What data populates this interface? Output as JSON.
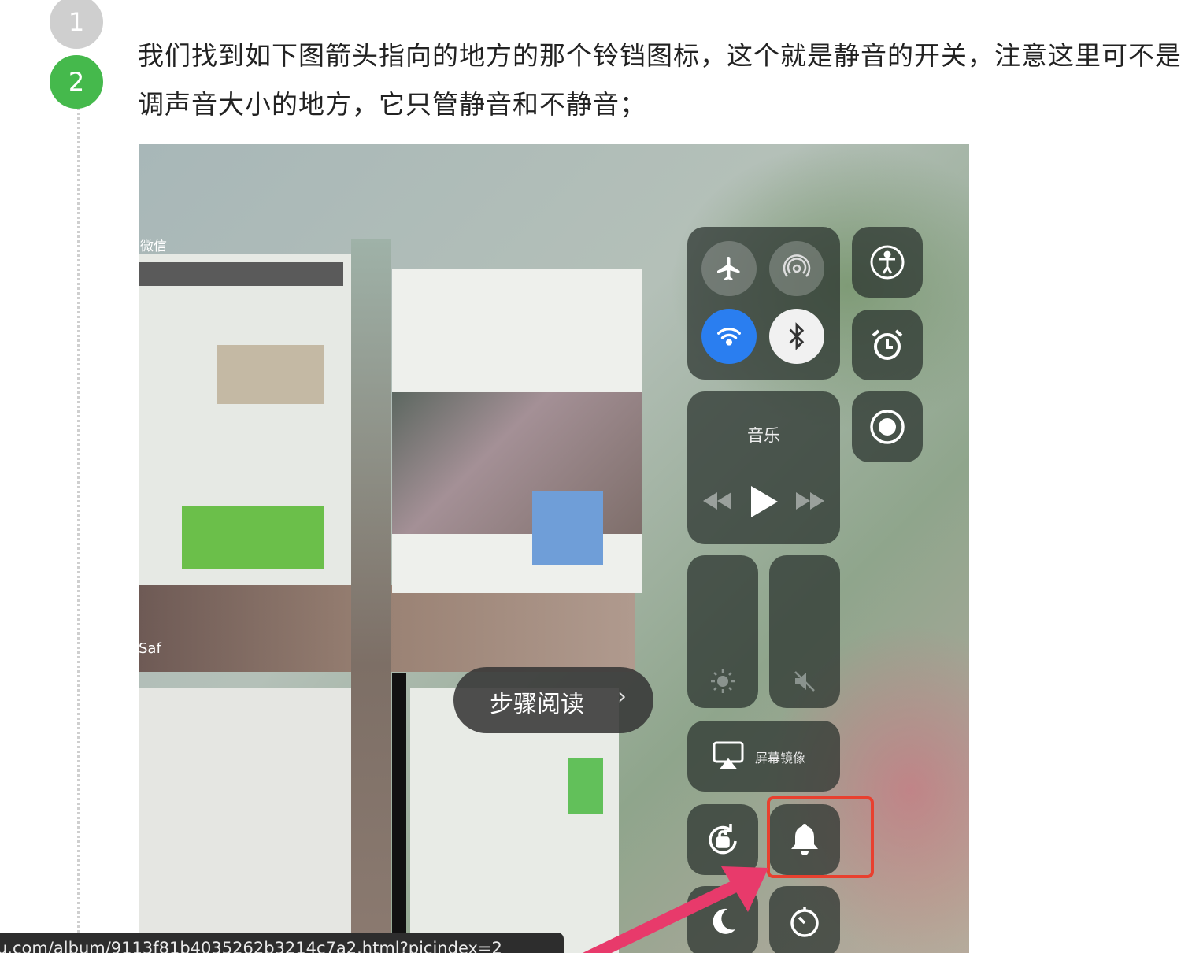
{
  "steps": [
    {
      "number": "1"
    },
    {
      "number": "2",
      "text": "我们找到如下图箭头指向的地方的那个铃铛图标，这个就是静音的开关，注意这里可不是调声音大小的地方，它只管静音和不静音；"
    }
  ],
  "screenshot": {
    "app_label_1": "微信",
    "app_label_2": "Saf",
    "music_tile_label": "音乐",
    "screen_mirror_label": "屏幕镜像",
    "step_reading_button": "步骤阅读",
    "chevron": "›",
    "icons": [
      "airplane-icon",
      "airdrop-icon",
      "wifi-icon",
      "bluetooth-icon",
      "accessibility-icon",
      "alarm-icon",
      "record-icon",
      "rewind-icon",
      "play-icon",
      "forward-icon",
      "brightness-icon",
      "mute-icon",
      "screen-mirror-icon",
      "rotation-lock-icon",
      "bell-icon",
      "moon-icon",
      "timer-icon"
    ],
    "colors": {
      "highlight": "#e8402f",
      "arrow": "#e83a6b",
      "wifi_active": "#2a7ef0",
      "step_active": "#45b94c"
    }
  },
  "status_url": "u.com/album/9113f81b4035262b3214c7a2.html?picindex=2"
}
